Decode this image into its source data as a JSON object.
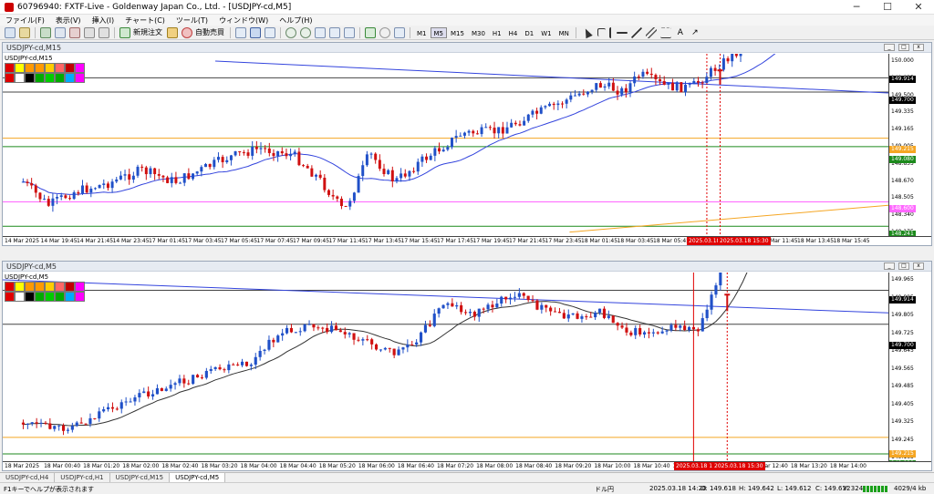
{
  "window": {
    "title": "60796940: FXTF-Live - Goldenway Japan Co., Ltd. - [USDJPY-cd,M5]",
    "minimize": "─",
    "maximize": "☐",
    "close": "✕"
  },
  "menu": [
    "ファイル(F)",
    "表示(V)",
    "挿入(I)",
    "チャート(C)",
    "ツール(T)",
    "ウィンドウ(W)",
    "ヘルプ(H)"
  ],
  "toolbar": {
    "new_order": "新規注文",
    "auto_trading": "自動売買",
    "timeframes": [
      "M1",
      "M5",
      "M15",
      "M30",
      "H1",
      "H4",
      "D1",
      "W1",
      "MN"
    ],
    "active_timeframe": "M5"
  },
  "colors": {
    "bull": "#2050c8",
    "bear": "#d01010",
    "ma": "#3344dd",
    "trend": "#3344dd",
    "orange": "#f5a623",
    "green": "#1c8a1c",
    "magenta": "#ff66ff",
    "red": "#e00000"
  },
  "palette": [
    "#e00000",
    "#ffff00",
    "#ff9900",
    "#ff9900",
    "#ffcc00",
    "#ff6666",
    "#c00000",
    "#ff00ff",
    "#e00000",
    "#ffffff",
    "#000000",
    "#00aa00",
    "#00cc00",
    "#00aa00",
    "#00aaff",
    "#ff00ff"
  ],
  "chart_top": {
    "window_title": "USDJPY-cd,M15",
    "symbol_label": "USDJPY-cd,M15",
    "price_ticks": [
      "150.000",
      "149.835",
      "149.500",
      "149.335",
      "149.165",
      "149.005",
      "148.835",
      "148.670",
      "148.505",
      "148.340",
      "148.175"
    ],
    "price_tags": [
      {
        "label": "149.914",
        "bg": "#000000",
        "fg": "#ffffff"
      },
      {
        "label": "149.700",
        "bg": "#000000",
        "fg": "#ffffff"
      },
      {
        "label": "149.215",
        "bg": "#f5a623",
        "fg": "#ffffff"
      },
      {
        "label": "149.080",
        "bg": "#1c8a1c",
        "fg": "#ffffff"
      },
      {
        "label": "148.600",
        "bg": "#ff66ff",
        "fg": "#ffffff"
      },
      {
        "label": "148.241",
        "bg": "#1c8a1c",
        "fg": "#ffffff"
      }
    ],
    "time_ticks": [
      "14 Mar 2025",
      "14 Mar 19:45",
      "14 Mar 21:45",
      "14 Mar 23:45",
      "17 Mar 01:45",
      "17 Mar 03:45",
      "17 Mar 05:45",
      "17 Mar 07:45",
      "17 Mar 09:45",
      "17 Mar 11:45",
      "17 Mar 13:45",
      "17 Mar 15:45",
      "17 Mar 17:45",
      "17 Mar 19:45",
      "17 Mar 21:45",
      "17 Mar 23:45",
      "18 Mar 01:45",
      "18 Mar 03:45",
      "18 Mar 05:45",
      "18 Mar 07:45",
      "18 Mar 09:45",
      "18 Mar 11:45",
      "18 Mar 13:45",
      "18 Mar 15:45"
    ],
    "time_tags": [
      "2025.03.18 14:4",
      "2025.03.18 15:30"
    ]
  },
  "chart_bottom": {
    "window_title": "USDJPY-cd,M5",
    "symbol_label": "USDJPY-cd,M5",
    "price_ticks": [
      "149.965",
      "149.885",
      "149.805",
      "149.725",
      "149.645",
      "149.565",
      "149.485",
      "149.405",
      "149.325",
      "149.245",
      "149.165"
    ],
    "price_tags": [
      {
        "label": "149.914",
        "bg": "#000000",
        "fg": "#ffffff"
      },
      {
        "label": "149.700",
        "bg": "#000000",
        "fg": "#ffffff"
      },
      {
        "label": "149.215",
        "bg": "#f5a623",
        "fg": "#ffffff"
      },
      {
        "label": "149.080",
        "bg": "#1c8a1c",
        "fg": "#ffffff"
      }
    ],
    "time_ticks": [
      "18 Mar 2025",
      "18 Mar 00:40",
      "18 Mar 01:20",
      "18 Mar 02:00",
      "18 Mar 02:40",
      "18 Mar 03:20",
      "18 Mar 04:00",
      "18 Mar 04:40",
      "18 Mar 05:20",
      "18 Mar 06:00",
      "18 Mar 06:40",
      "18 Mar 07:20",
      "18 Mar 08:00",
      "18 Mar 08:40",
      "18 Mar 09:20",
      "18 Mar 10:00",
      "18 Mar 10:40",
      "18 Mar 11:20",
      "18 Mar 12:00",
      "18 Mar 12:40",
      "18 Mar 13:20",
      "18 Mar 14:00"
    ],
    "time_tags": [
      "2025.03.18 14:4",
      "2025.03.18 15:30"
    ]
  },
  "tabs": [
    "USDJPY-cd,H4",
    "USDJPY-cd,H1",
    "USDJPY-cd,M15",
    "USDJPY-cd,M5"
  ],
  "active_tab": "USDJPY-cd,M5",
  "status": {
    "help": "F1キーでヘルプが表示されます",
    "profile": "ドル円",
    "datetime": "2025.03.18 14:20",
    "open": "O: 149.618",
    "high": "H: 149.642",
    "low": "L: 149.612",
    "close": "C: 149.632",
    "volume": "V: 324",
    "traffic": "4029/4 kb"
  }
}
